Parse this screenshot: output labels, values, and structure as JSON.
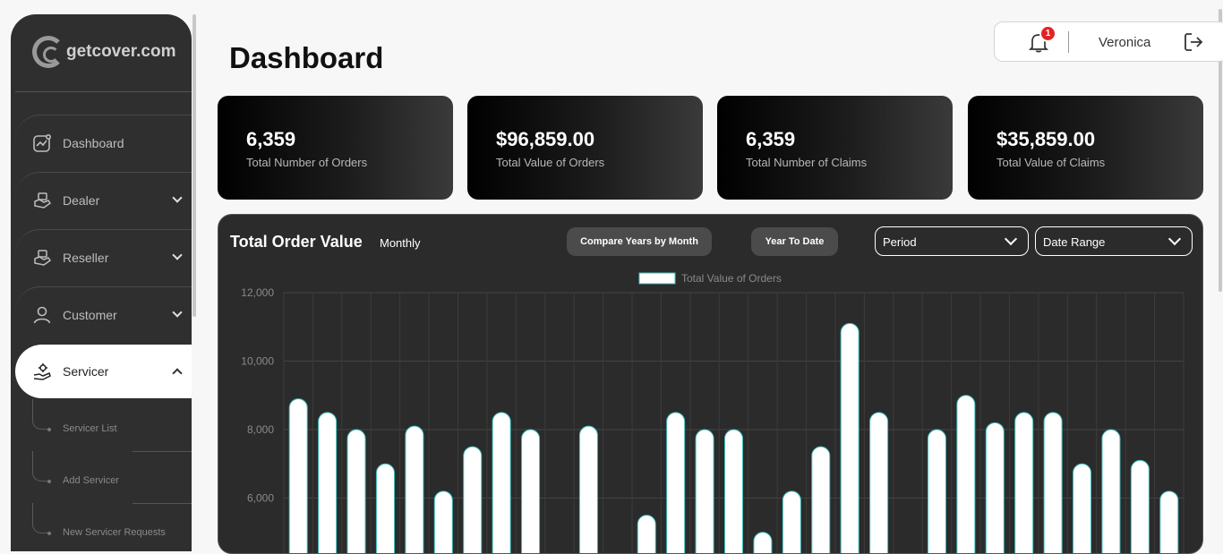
{
  "app": {
    "logo_text": "getcover.com",
    "page_title": "Dashboard"
  },
  "header": {
    "notifications_count": "1",
    "user_name": "Veronica"
  },
  "sidebar": {
    "items": [
      {
        "label": "Dashboard",
        "icon": "dashboard-icon"
      },
      {
        "label": "Dealer",
        "icon": "dealer-icon"
      },
      {
        "label": "Reseller",
        "icon": "reseller-icon"
      },
      {
        "label": "Customer",
        "icon": "customer-icon"
      },
      {
        "label": "Servicer",
        "icon": "servicer-icon"
      }
    ],
    "servicer_sub_items": [
      "Servicer List",
      "Add Servicer",
      "New Servicer Requests"
    ]
  },
  "cards": [
    {
      "value": "6,359",
      "label": "Total Number of Orders"
    },
    {
      "value": "$96,859.00",
      "label": "Total Value of Orders"
    },
    {
      "value": "6,359",
      "label": "Total Number of Claims"
    },
    {
      "value": "$35,859.00",
      "label": "Total Value of Claims"
    }
  ],
  "chart_panel": {
    "title": "Total Order Value",
    "subtitle": "Monthly",
    "compare_button": "Compare Years by Month",
    "ytd_button": "Year To Date",
    "period_select": "Period",
    "range_select": "Date Range"
  },
  "chart_data": {
    "type": "bar",
    "legend": [
      "Total Value of Orders"
    ],
    "ylim": [
      0,
      12000
    ],
    "yticks": [
      "12,000",
      "10,000",
      "8,000",
      "6,000"
    ],
    "series": [
      {
        "name": "Total Value of Orders",
        "values": [
          8900,
          8500,
          8000,
          7000,
          8100,
          6200,
          7500,
          8500,
          8000,
          null,
          8100,
          null,
          5500,
          8500,
          8000,
          8000,
          5000,
          6200,
          7500,
          11100,
          8500,
          null,
          8000,
          9000,
          8200,
          8500,
          8500,
          7000,
          8000,
          7100,
          6200
        ]
      }
    ],
    "colors": {
      "bar_fill": "#ffffff",
      "bar_stroke": "#3fbfbf",
      "background": "#2b2b2b"
    }
  }
}
